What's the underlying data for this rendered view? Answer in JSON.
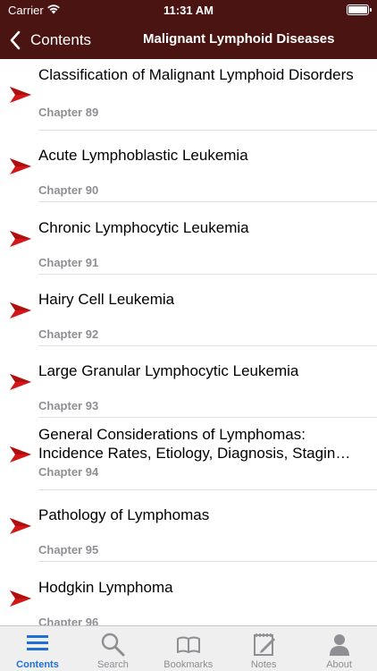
{
  "status": {
    "carrier": "Carrier",
    "time": "11:31 AM"
  },
  "nav": {
    "back_label": "Contents",
    "title": "Malignant Lymphoid Diseases"
  },
  "colors": {
    "header_bg": "#4a1412",
    "arrow": "#d41616",
    "tab_active": "#1f6fd6",
    "tab_inactive": "#8e8e93"
  },
  "chapters": [
    {
      "title": "Classification of Malignant Lymphoid Disorders",
      "chapter": "Chapter 89"
    },
    {
      "title": "Acute Lymphoblastic Leukemia",
      "chapter": "Chapter 90"
    },
    {
      "title": "Chronic Lymphocytic Leukemia",
      "chapter": "Chapter 91"
    },
    {
      "title": "Hairy Cell Leukemia",
      "chapter": "Chapter 92"
    },
    {
      "title": "Large Granular Lymphocytic Leukemia",
      "chapter": "Chapter 93"
    },
    {
      "title": "General Considerations of Lymphomas: Incidence Rates, Etiology, Diagnosis, Stagin…",
      "chapter": "Chapter 94"
    },
    {
      "title": "Pathology of Lymphomas",
      "chapter": "Chapter 95"
    },
    {
      "title": "Hodgkin Lymphoma",
      "chapter": "Chapter 96"
    }
  ],
  "tabs": [
    {
      "label": "Contents",
      "icon": "list-icon",
      "active": true
    },
    {
      "label": "Search",
      "icon": "search-icon",
      "active": false
    },
    {
      "label": "Bookmarks",
      "icon": "book-icon",
      "active": false
    },
    {
      "label": "Notes",
      "icon": "notebook-icon",
      "active": false
    },
    {
      "label": "About",
      "icon": "person-icon",
      "active": false
    }
  ]
}
